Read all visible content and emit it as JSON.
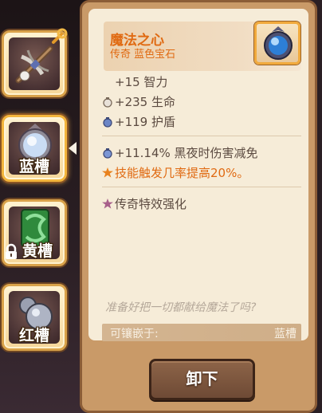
{
  "slots": [
    {
      "label": "",
      "icon": "crossbow-icon",
      "locked": false,
      "active": false
    },
    {
      "label": "蓝槽",
      "icon": "blue-gem-icon",
      "locked": false,
      "active": true
    },
    {
      "label": "黄槽",
      "icon": "green-gem-icon",
      "locked": true,
      "active": false
    },
    {
      "label": "红槽",
      "icon": "silver-gem-icon",
      "locked": false,
      "active": false
    }
  ],
  "item": {
    "title": "魔法之心",
    "subtitle": "传奇 蓝色宝石",
    "icon": "blue-orb-gem-icon"
  },
  "stats": {
    "intelligence": "+15 智力",
    "health": "+235 生命",
    "shield": "+119 护盾"
  },
  "effects": {
    "night_reduction": "+11.14% 黑夜时伤害减免",
    "skill_trigger": "技能触发几率提高20%。"
  },
  "legendary": "传奇特效强化",
  "flavor_text": "准备好把一切都献给魔法了吗?",
  "socket": {
    "label": "可镶嵌于:",
    "value": "蓝槽"
  },
  "button": {
    "unequip": "卸下"
  },
  "colors": {
    "accent_orange": "#e06a12",
    "text_body": "#5b4a40",
    "panel_bg": "#f6ecd8",
    "frame": "#c99a68"
  }
}
